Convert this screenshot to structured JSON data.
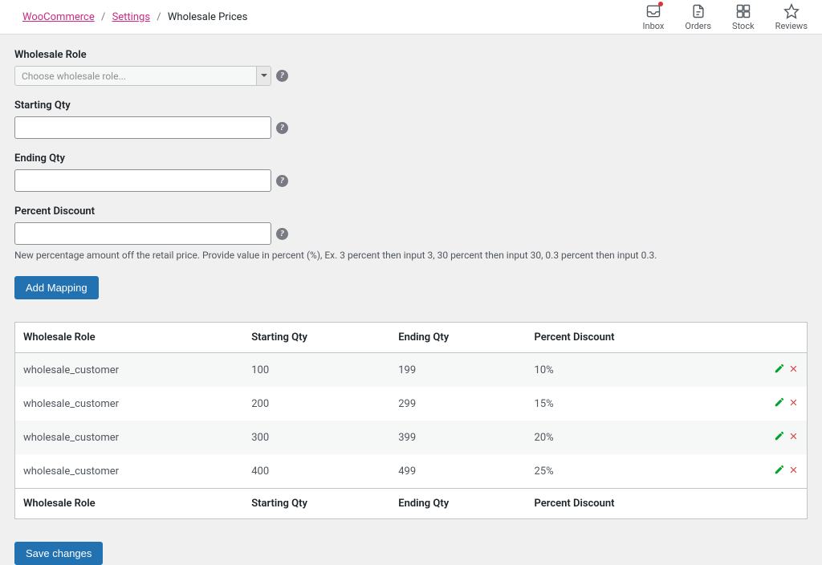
{
  "breadcrumb": {
    "root": "WooCommerce",
    "settings": "Settings",
    "current": "Wholesale Prices"
  },
  "topbar": {
    "inbox": "Inbox",
    "orders": "Orders",
    "stock": "Stock",
    "reviews": "Reviews"
  },
  "fields": {
    "role_label": "Wholesale Role",
    "role_placeholder": "Choose wholesale role...",
    "starting_qty_label": "Starting Qty",
    "ending_qty_label": "Ending Qty",
    "percent_discount_label": "Percent Discount",
    "percent_discount_help": "New percentage amount off the retail price. Provide value in percent (%), Ex. 3 percent then input 3, 30 percent then input 30, 0.3 percent then input 0.3."
  },
  "buttons": {
    "add_mapping": "Add Mapping",
    "save_changes": "Save changes"
  },
  "table": {
    "headers": {
      "role": "Wholesale Role",
      "starting_qty": "Starting Qty",
      "ending_qty": "Ending Qty",
      "percent": "Percent Discount"
    },
    "rows": [
      {
        "role": "wholesale_customer",
        "starting_qty": "100",
        "ending_qty": "199",
        "percent": "10%"
      },
      {
        "role": "wholesale_customer",
        "starting_qty": "200",
        "ending_qty": "299",
        "percent": "15%"
      },
      {
        "role": "wholesale_customer",
        "starting_qty": "300",
        "ending_qty": "399",
        "percent": "20%"
      },
      {
        "role": "wholesale_customer",
        "starting_qty": "400",
        "ending_qty": "499",
        "percent": "25%"
      }
    ]
  }
}
